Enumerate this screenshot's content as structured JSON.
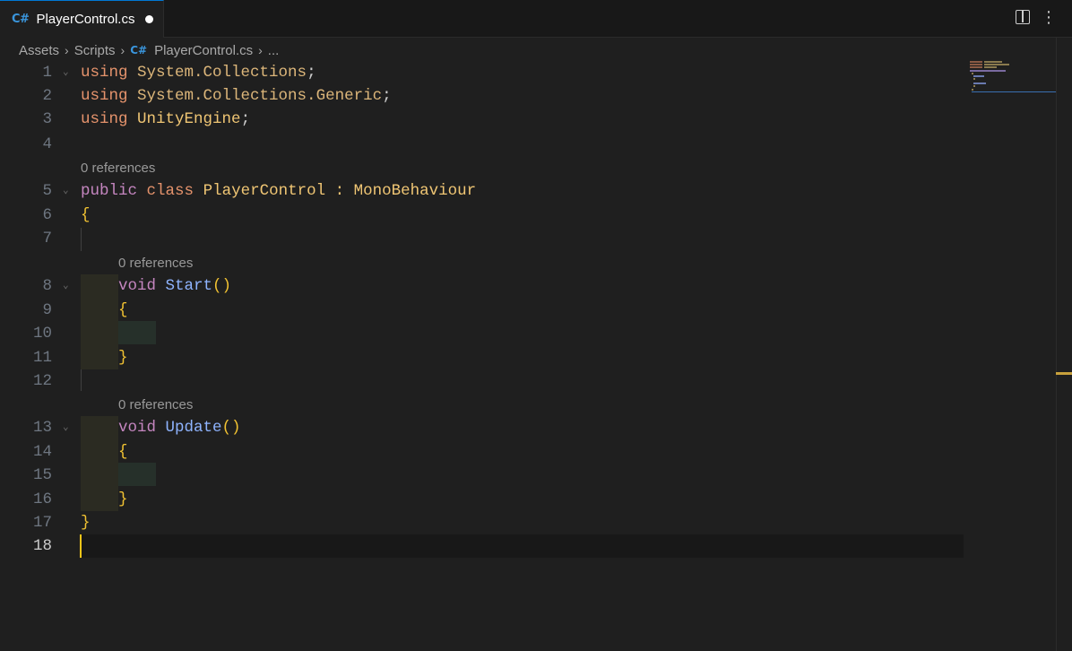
{
  "tab": {
    "lang_badge": "C#",
    "filename": "PlayerControl.cs"
  },
  "tab_actions": {
    "split_icon": "split-editor-icon",
    "more_icon": "more-actions-icon",
    "more_label": "⋮"
  },
  "breadcrumb": {
    "items": [
      "Assets",
      "Scripts"
    ],
    "file_badge": "C#",
    "file": "PlayerControl.cs",
    "ellipsis": "..."
  },
  "editor": {
    "line_numbers": [
      "1",
      "2",
      "3",
      "4",
      "5",
      "6",
      "7",
      "8",
      "9",
      "10",
      "11",
      "12",
      "13",
      "14",
      "15",
      "16",
      "17",
      "18"
    ],
    "active_line": "18",
    "codelens": [
      "0 references",
      "0 references",
      "0 references"
    ],
    "lines": {
      "l1": {
        "kw": "using",
        "ns": "System.Collections",
        "p": ";"
      },
      "l2": {
        "kw": "using",
        "ns": "System.Collections.Generic",
        "p": ";"
      },
      "l3": {
        "kw": "using",
        "ns": "UnityEngine",
        "p": ";"
      },
      "l5": {
        "kw1": "public",
        "kw2": "class",
        "name": "PlayerControl",
        "colon": ":",
        "base": "MonoBehaviour"
      },
      "l6": "{",
      "l8": {
        "kw": "void",
        "fn": "Start",
        "parens": "()"
      },
      "l9": "{",
      "l11": "}",
      "l13": {
        "kw": "void",
        "fn": "Update",
        "parens": "()"
      },
      "l14": "{",
      "l16": "}",
      "l17": "}"
    }
  },
  "colors": {
    "accent": "#0078d4",
    "cursor": "#f5c518",
    "background": "#1f1f1f"
  }
}
